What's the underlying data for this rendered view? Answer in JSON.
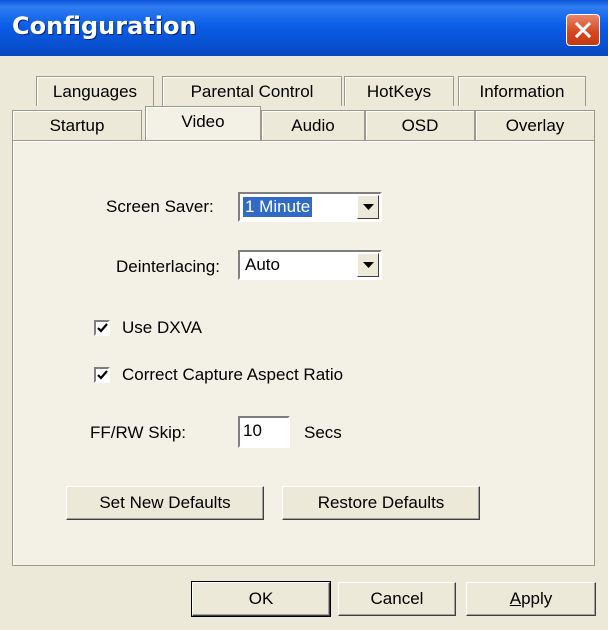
{
  "window": {
    "title": "Configuration"
  },
  "tabs": {
    "row_back": [
      "Languages",
      "Parental Control",
      "HotKeys",
      "Information"
    ],
    "row_front": [
      "Startup",
      "Video",
      "Audio",
      "OSD",
      "Overlay"
    ],
    "active": "Video"
  },
  "video": {
    "screen_saver_label": "Screen Saver:",
    "screen_saver_value": "1 Minute",
    "deinterlacing_label": "Deinterlacing:",
    "deinterlacing_value": "Auto",
    "use_dxva_label": "Use DXVA",
    "use_dxva_checked": true,
    "correct_aspect_label": "Correct Capture Aspect Ratio",
    "correct_aspect_checked": true,
    "skip_label": "FF/RW Skip:",
    "skip_value": "10",
    "skip_unit": "Secs",
    "set_defaults_label": "Set New Defaults",
    "restore_defaults_label": "Restore Defaults"
  },
  "footer": {
    "ok_label": "OK",
    "cancel_label": "Cancel",
    "apply_label_rest": "pply",
    "apply_label_mnemonic": "A"
  },
  "icons": {
    "close": "close-icon",
    "dropdown": "chevron-down-icon",
    "check": "check-icon"
  }
}
